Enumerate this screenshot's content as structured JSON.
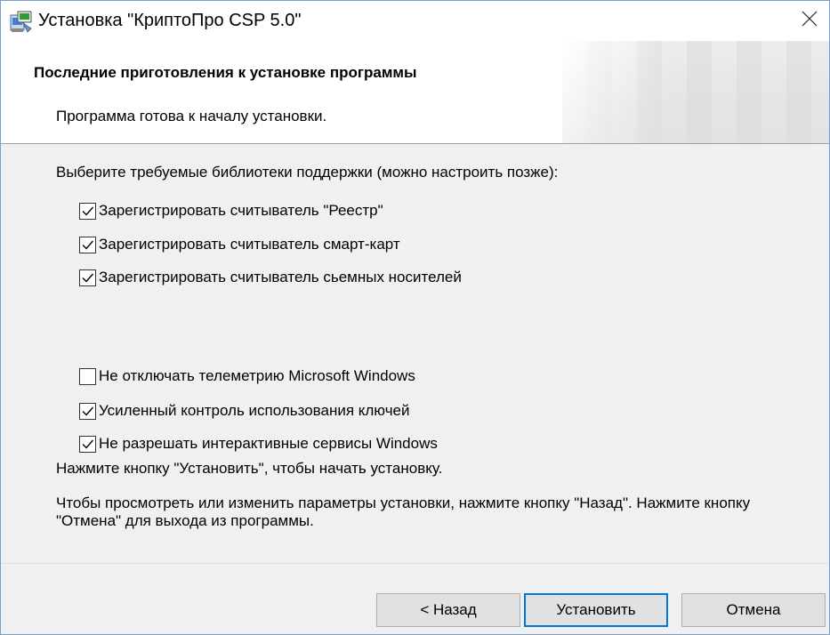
{
  "window": {
    "title": "Установка \"КриптоПро CSP 5.0\"",
    "app_icon": "installer-icon",
    "close_icon": "close-icon"
  },
  "header": {
    "title": "Последние приготовления к установке программы",
    "subtitle": "Программа готова к началу установки."
  },
  "main": {
    "libraries_prompt": "Выберите требуемые библиотеки поддержки (можно настроить позже):",
    "reader_options": [
      {
        "label": "Зарегистрировать считыватель \"Реестр\"",
        "checked": true
      },
      {
        "label": "Зарегистрировать считыватель смарт-карт",
        "checked": true
      },
      {
        "label": "Зарегистрировать считыватель сьемных носителей",
        "checked": true
      }
    ],
    "extra_options": [
      {
        "label": "Не отключать телеметрию Microsoft Windows",
        "checked": false
      },
      {
        "label": "Усиленный контроль использования ключей",
        "checked": true
      },
      {
        "label": "Не разрешать интерактивные сервисы Windows",
        "checked": true
      }
    ],
    "install_hint": "Нажмите кнопку \"Установить\", чтобы начать установку.",
    "change_hint": "Чтобы просмотреть или изменить параметры установки, нажмите кнопку \"Назад\". Нажмите кнопку \"Отмена\" для выхода из программы."
  },
  "footer": {
    "back_label": "< Назад",
    "install_label": "Установить",
    "cancel_label": "Отмена"
  },
  "colors": {
    "accent": "#0078d7",
    "button_face": "#e1e1e1",
    "dialog_bg": "#f0f0f0"
  }
}
